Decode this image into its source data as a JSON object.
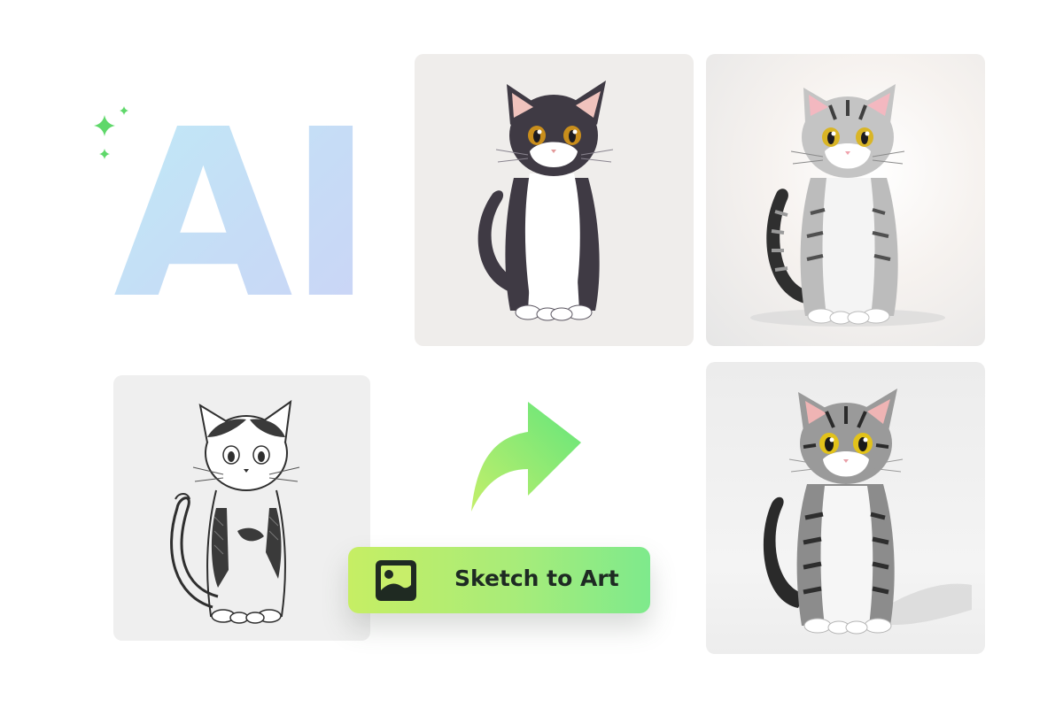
{
  "hero": {
    "ai_text": "AI",
    "sparkle_color": "#5fd86a",
    "gradient": [
      "#bfeaf7",
      "#cbd4f6"
    ]
  },
  "cards": [
    {
      "name": "anime-cat",
      "style": "anime illustration",
      "fur": [
        "#3f3a44",
        "#ffffff"
      ]
    },
    {
      "name": "gray-tabby-render",
      "style": "3d render",
      "fur": [
        "#8a8a8a",
        "#ffffff"
      ]
    },
    {
      "name": "pencil-sketch-cat",
      "style": "pencil sketch",
      "fur": [
        "#2f2f2f",
        "#ffffff"
      ]
    },
    {
      "name": "photo-tabby-cat",
      "style": "photorealistic",
      "fur": [
        "#5a5a5a",
        "#ffffff"
      ]
    }
  ],
  "arrow": {
    "icon": "redo-arrow-icon",
    "gradient": [
      "#b7ee6e",
      "#62e57c"
    ]
  },
  "badge": {
    "icon": "image-icon",
    "label": "Sketch to Art",
    "gradient": [
      "#c6ee64",
      "#7eea8c"
    ]
  }
}
